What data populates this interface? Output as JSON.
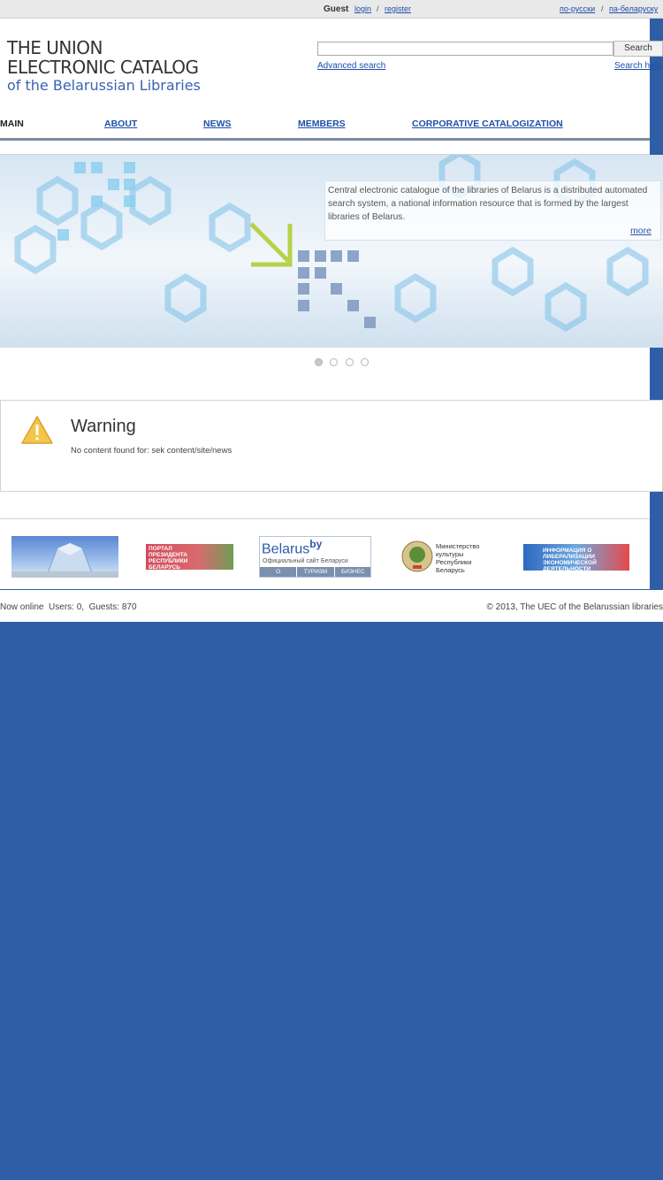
{
  "topbar": {
    "user": "Guest",
    "login": "login",
    "separator": "/",
    "register": "register",
    "lang_ru": "по-русски",
    "lang_be": "па-беларуску"
  },
  "logo": {
    "line1": "THE UNION",
    "line2": "ELECTRONIC CATALOG",
    "line3": "of the Belarussian Libraries"
  },
  "search": {
    "placeholder": "",
    "button": "Search",
    "advanced": "Advanced search",
    "help": "Search help"
  },
  "nav": {
    "main": "MAIN",
    "about": "ABOUT",
    "news": "NEWS",
    "members": "MEMBERS",
    "corporative": "CORPORATIVE CATALOGIZATION"
  },
  "banner": {
    "text": "Central electronic catalogue of the libraries of Belarus is a distributed automated search system, a national information resource that is formed by the largest libraries of Belarus.",
    "more": "more",
    "slides": 4,
    "active_slide": 1
  },
  "warning": {
    "title": "Warning",
    "message": "No content found for: sek content/site/news"
  },
  "partners": {
    "president": "ПОРТАЛ ПРЕЗИДЕНТА РЕСПУБЛИКИ БЕЛАРУСЬ",
    "belarus_brand": "Belarus",
    "belarus_by": "by",
    "belarus_sub": "Официальный сайт Беларуси",
    "belarus_tab1": "О БЕЛАРУСИ",
    "belarus_tab2": "ТУРИЗМ",
    "belarus_tab3": "БИЗНЕС",
    "ministry": "Министерство культуры Республики Беларусь",
    "liberalization": "ИНФОРМАЦИЯ О ЛИБЕРАЛИЗАЦИИ ЭКОНОМИЧЕСКОЙ ДЕЯТЕЛЬНОСТИ"
  },
  "footer": {
    "online": "Now online  Users: 0,  Guests: 870",
    "copyright": "© 2013, The UEC of the Belarussian libraries"
  },
  "colors": {
    "background": "#2e5fa6",
    "link": "#1f4fa8",
    "accent_orange": "#e8a93a"
  }
}
